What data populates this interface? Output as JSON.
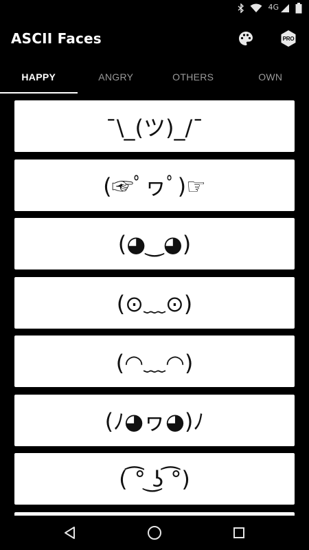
{
  "status_bar": {
    "network_label": "4G",
    "icons": [
      "bluetooth-icon",
      "wifi-icon",
      "cell-signal-icon",
      "battery-icon"
    ]
  },
  "app_bar": {
    "title": "ASCII Faces",
    "actions": [
      {
        "name": "palette-icon"
      },
      {
        "name": "pro-badge",
        "label": "PRO"
      }
    ]
  },
  "tabs": [
    {
      "label": "HAPPY",
      "active": true
    },
    {
      "label": "ANGRY",
      "active": false
    },
    {
      "label": "OTHERS",
      "active": false
    },
    {
      "label": "OWN",
      "active": false
    }
  ],
  "faces": [
    "¯\\_(ツ)_/¯",
    "(☞ﾟヮﾟ)☞",
    "(◕‿◕)",
    "(⊙﹏⊙)",
    "(◠﹏◠)",
    "(ﾉ◕ヮ◕)ﾉ",
    "( ͡° ͜ʖ ͡°)"
  ],
  "nav_bar": [
    "back-icon",
    "home-icon",
    "recents-icon"
  ]
}
